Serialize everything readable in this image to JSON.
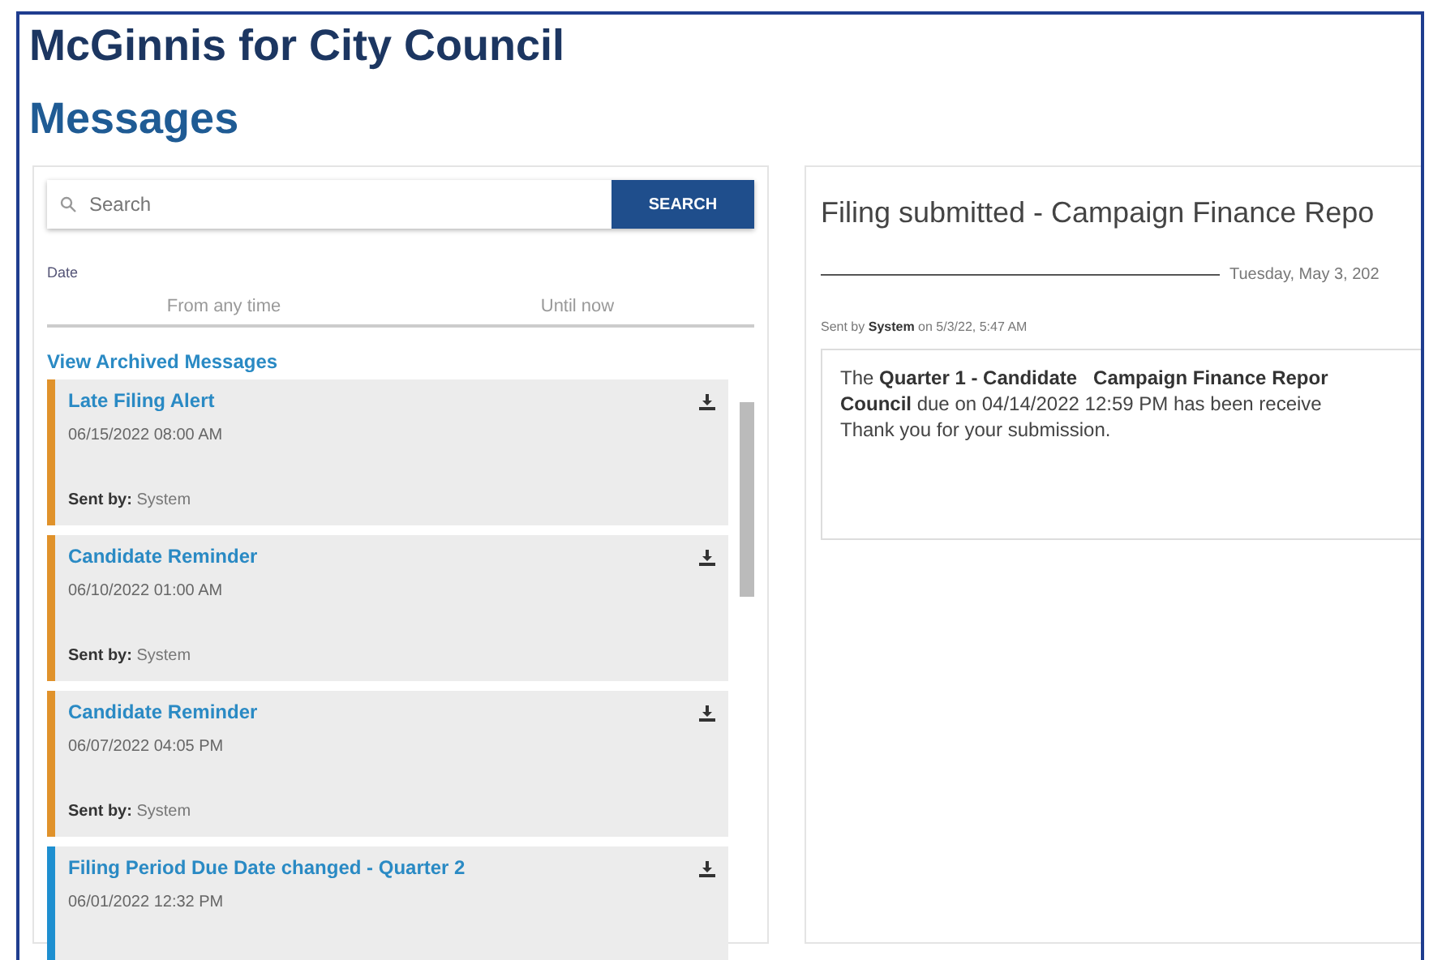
{
  "header": {
    "title": "McGinnis for City Council",
    "subtitle": "Messages"
  },
  "search": {
    "placeholder": "Search",
    "button": "SEARCH"
  },
  "date_filter": {
    "label": "Date",
    "from": "From any time",
    "until": "Until now"
  },
  "archive_link": "View Archived Messages",
  "messages": [
    {
      "title": "Late Filing Alert",
      "date": "06/15/2022 08:00 AM",
      "sent_by_label": "Sent by:",
      "sender": "System",
      "color": "#e0922b"
    },
    {
      "title": "Candidate Reminder",
      "date": "06/10/2022 01:00 AM",
      "sent_by_label": "Sent by:",
      "sender": "System",
      "color": "#e0922b"
    },
    {
      "title": "Candidate Reminder",
      "date": "06/07/2022 04:05 PM",
      "sent_by_label": "Sent by:",
      "sender": "System",
      "color": "#e0922b"
    },
    {
      "title": "Filing Period Due Date changed - Quarter 2",
      "date": "06/01/2022 12:32 PM",
      "color": "#1e8fd0"
    }
  ],
  "detail": {
    "title": "Filing submitted - Campaign Finance Repo",
    "day": "Tuesday, May 3, 202",
    "sent_line": "Sent by **System** on 5/3/22, 5:47 AM",
    "body_lines": [
      "The **Quarter 1 - Candidate   Campaign Finance Repor**",
      "**Council** due on 04/14/2022 12:59 PM has been receive",
      "Thank you for your submission."
    ]
  }
}
